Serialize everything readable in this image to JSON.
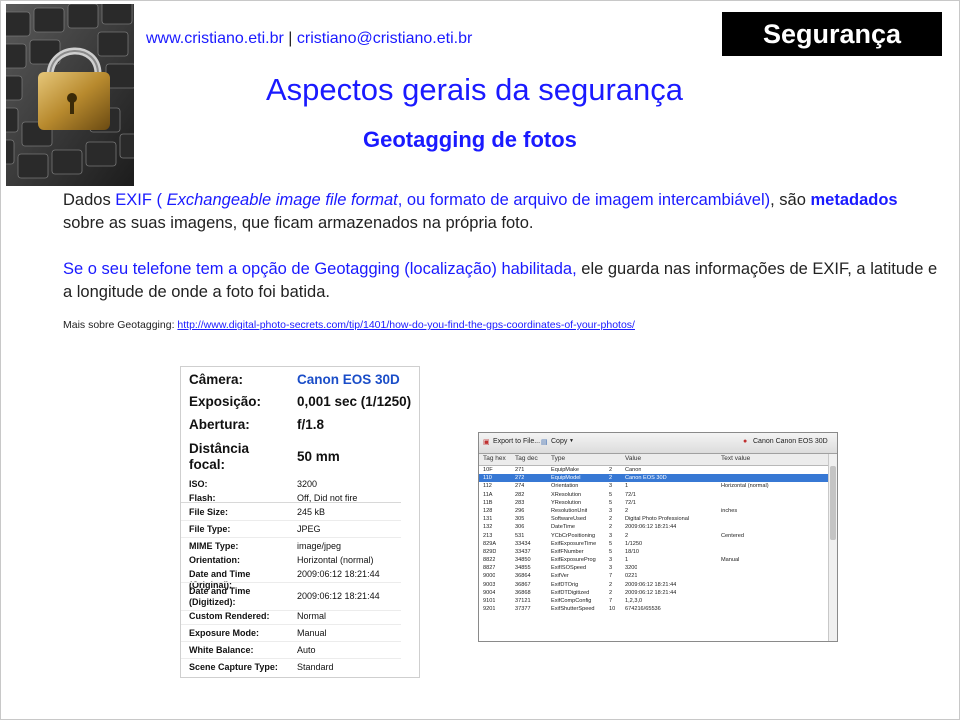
{
  "header": {
    "site_link": "www.cristiano.eti.br",
    "separator": "|",
    "email_link": "cristiano@cristiano.eti.br",
    "section": "Segurança"
  },
  "title": "Aspectos gerais da segurança",
  "subtitle": "Geotagging de fotos",
  "paragraph1": {
    "part1": "Dados ",
    "part2": "EXIF ( ",
    "part3": "Exchangeable image file format",
    "part4": ", ou formato de arquivo de imagem intercambiável)",
    "part5": ", são ",
    "part6": "metadados",
    "part7": " sobre as suas imagens, que ficam armazenados na própria foto."
  },
  "paragraph2": {
    "part1": "Se o seu telefone tem a opção de Geotagging (localização) habilitada,",
    "part2": " ele guarda nas informações de EXIF, a latitude e a longitude de onde a foto foi batida."
  },
  "more_info": {
    "label": "Mais sobre Geotagging: ",
    "url": "http://www.digital-photo-secrets.com/tip/1401/how-do-you-find-the-gps-coordinates-of-your-photos/"
  },
  "exif_card": {
    "top_rows": [
      {
        "label": "Câmera:",
        "value": "Canon EOS 30D"
      },
      {
        "label": "Exposição:",
        "value": "0,001 sec (1/1250)"
      },
      {
        "label": "Abertura:",
        "value": "f/1.8"
      },
      {
        "label": "Distância",
        "label2": "focal:",
        "value": "50 mm"
      }
    ],
    "rows": [
      {
        "label": "ISO:",
        "value": "3200"
      },
      {
        "label": "Flash:",
        "value": "Off, Did not fire"
      },
      {
        "label": "File Size:",
        "value": "245 kB"
      },
      {
        "label": "File Type:",
        "value": "JPEG"
      },
      {
        "label": "MIME Type:",
        "value": "image/jpeg"
      },
      {
        "label": "Orientation:",
        "value": "Horizontal (normal)"
      },
      {
        "label": "Date and Time (Original):",
        "value": "2009:06:12 18:21:44"
      },
      {
        "label": "Date and Time",
        "label2": "(Digitized):",
        "value": "2009:06:12 18:21:44"
      },
      {
        "label": "Custom Rendered:",
        "value": "Normal"
      },
      {
        "label": "Exposure Mode:",
        "value": "Manual"
      },
      {
        "label": "White Balance:",
        "value": "Auto"
      },
      {
        "label": "Scene Capture Type:",
        "value": "Standard"
      }
    ]
  },
  "tool_window": {
    "toolbar": {
      "export": "Export to File...",
      "copy": "Copy",
      "camera": "Canon Canon EOS 30D"
    },
    "columns": [
      "Tag hex",
      "Tag dec",
      "Type",
      "Value",
      "Text value"
    ],
    "rows": [
      [
        "10F",
        "271",
        "EquipMake",
        "2",
        "Canon",
        ""
      ],
      [
        "110",
        "272",
        "EquipModel",
        "2",
        "Canon EOS 30D",
        ""
      ],
      [
        "112",
        "274",
        "Orientation",
        "3",
        "1",
        "Horizontal (normal)"
      ],
      [
        "11A",
        "282",
        "XResolution",
        "5",
        "72/1",
        ""
      ],
      [
        "11B",
        "283",
        "YResolution",
        "5",
        "72/1",
        ""
      ],
      [
        "128",
        "296",
        "ResolutionUnit",
        "3",
        "2",
        "inches"
      ],
      [
        "131",
        "305",
        "SoftwareUsed",
        "2",
        "Digital Photo Professional",
        ""
      ],
      [
        "132",
        "306",
        "DateTime",
        "2",
        "2009:06:12 18:21:44",
        ""
      ],
      [
        "213",
        "531",
        "YCbCrPositioning",
        "3",
        "2",
        "Centered"
      ],
      [
        "829A",
        "33434",
        "ExifExposureTime",
        "5",
        "1/1250",
        ""
      ],
      [
        "829D",
        "33437",
        "ExifFNumber",
        "5",
        "18/10",
        ""
      ],
      [
        "8822",
        "34850",
        "ExifExposureProg",
        "3",
        "1",
        "Manual"
      ],
      [
        "8827",
        "34855",
        "ExifISOSpeed",
        "3",
        "3200",
        ""
      ],
      [
        "9000",
        "36864",
        "ExifVer",
        "7",
        "0221",
        ""
      ],
      [
        "9003",
        "36867",
        "ExifDTOrig",
        "2",
        "2009:06:12 18:21:44",
        ""
      ],
      [
        "9004",
        "36868",
        "ExifDTDigitized",
        "2",
        "2009:06:12 18:21:44",
        ""
      ],
      [
        "9101",
        "37121",
        "ExifCompConfig",
        "7",
        "1,2,3,0",
        ""
      ],
      [
        "9201",
        "37377",
        "ExifShutterSpeed",
        "10",
        "674216/65536",
        ""
      ]
    ]
  }
}
